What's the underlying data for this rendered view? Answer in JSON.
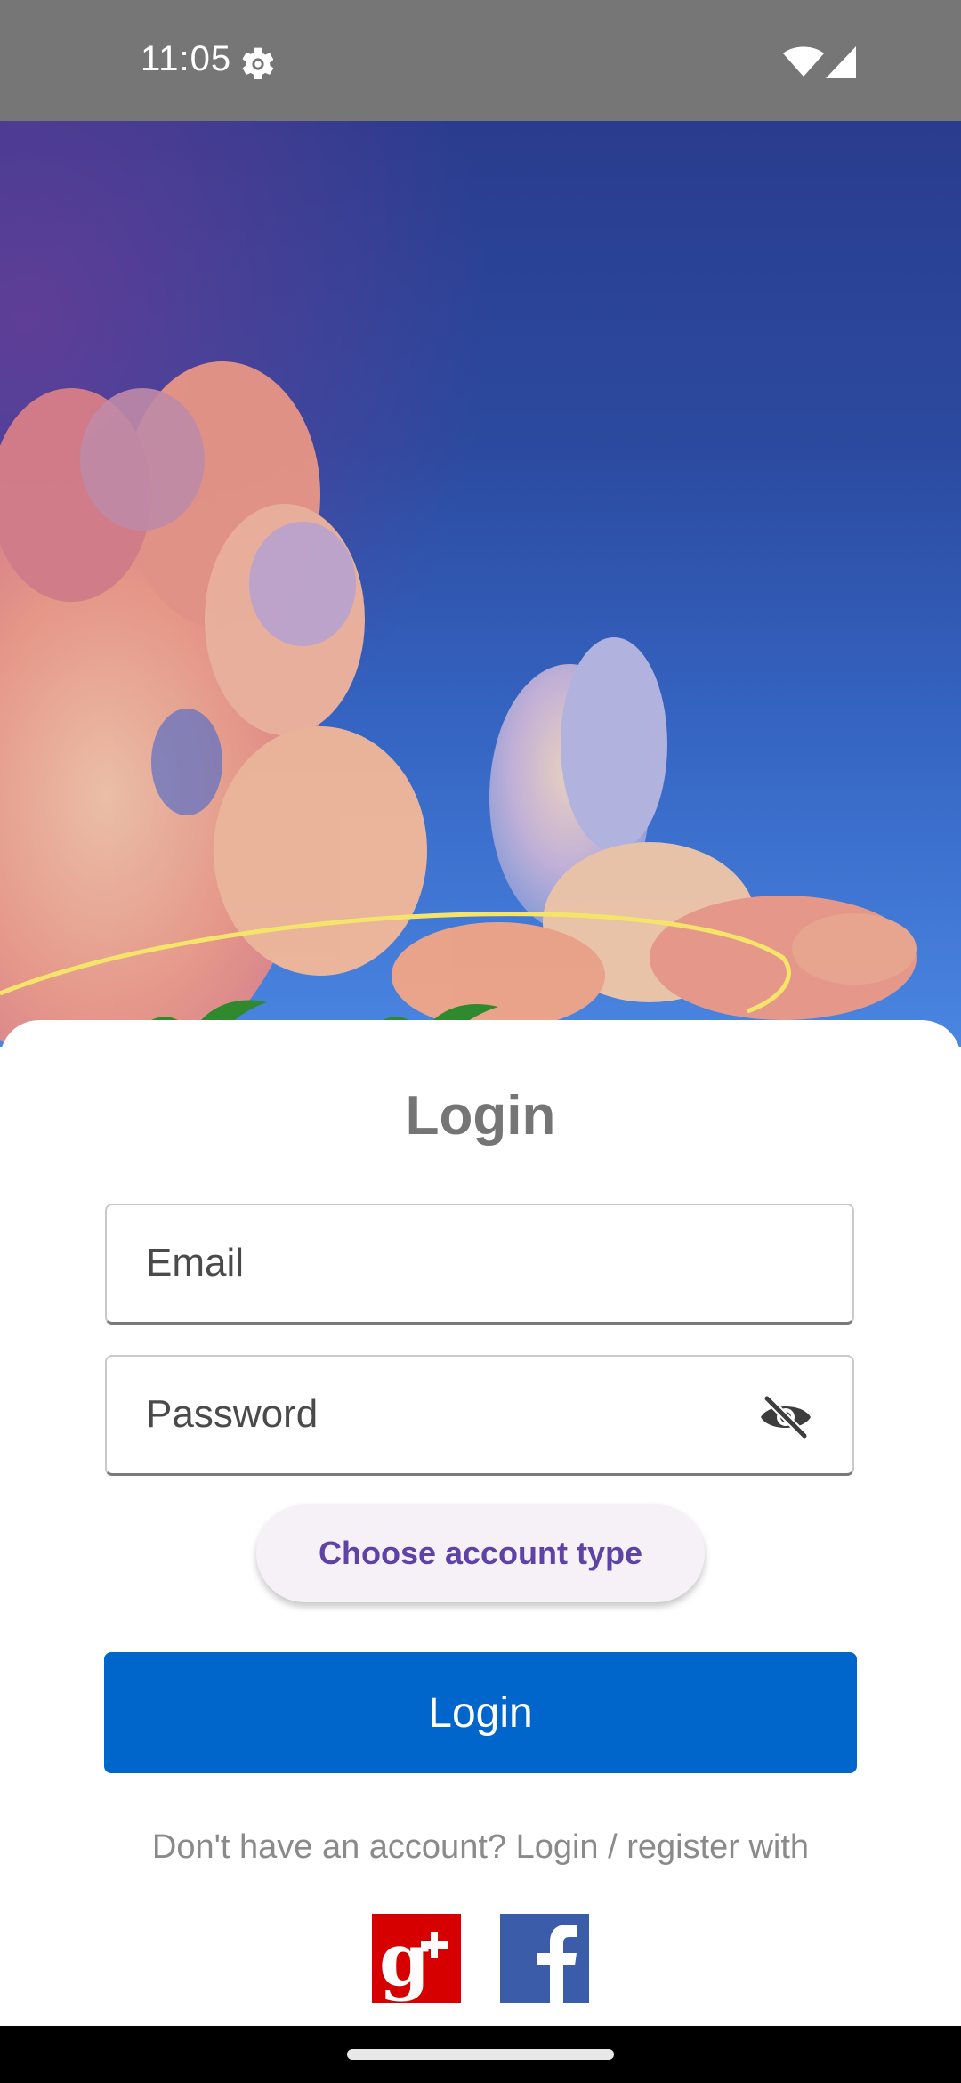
{
  "status_bar": {
    "time": "11:05"
  },
  "login": {
    "title": "Login",
    "email_placeholder": "Email",
    "password_placeholder": "Password",
    "choose_account_label": "Choose account type",
    "login_button_label": "Login",
    "register_prompt": "Don't have an account? Login / register with"
  },
  "colors": {
    "primary": "#0066cc",
    "accent_purple": "#5e42a6",
    "google_red": "#d60000",
    "facebook_blue": "#3b5ca8"
  },
  "icons": {
    "status": [
      "gear-icon",
      "wifi-icon",
      "signal-icon"
    ],
    "password_toggle": "eye-off-icon",
    "social": [
      "google-plus-icon",
      "facebook-icon"
    ]
  }
}
